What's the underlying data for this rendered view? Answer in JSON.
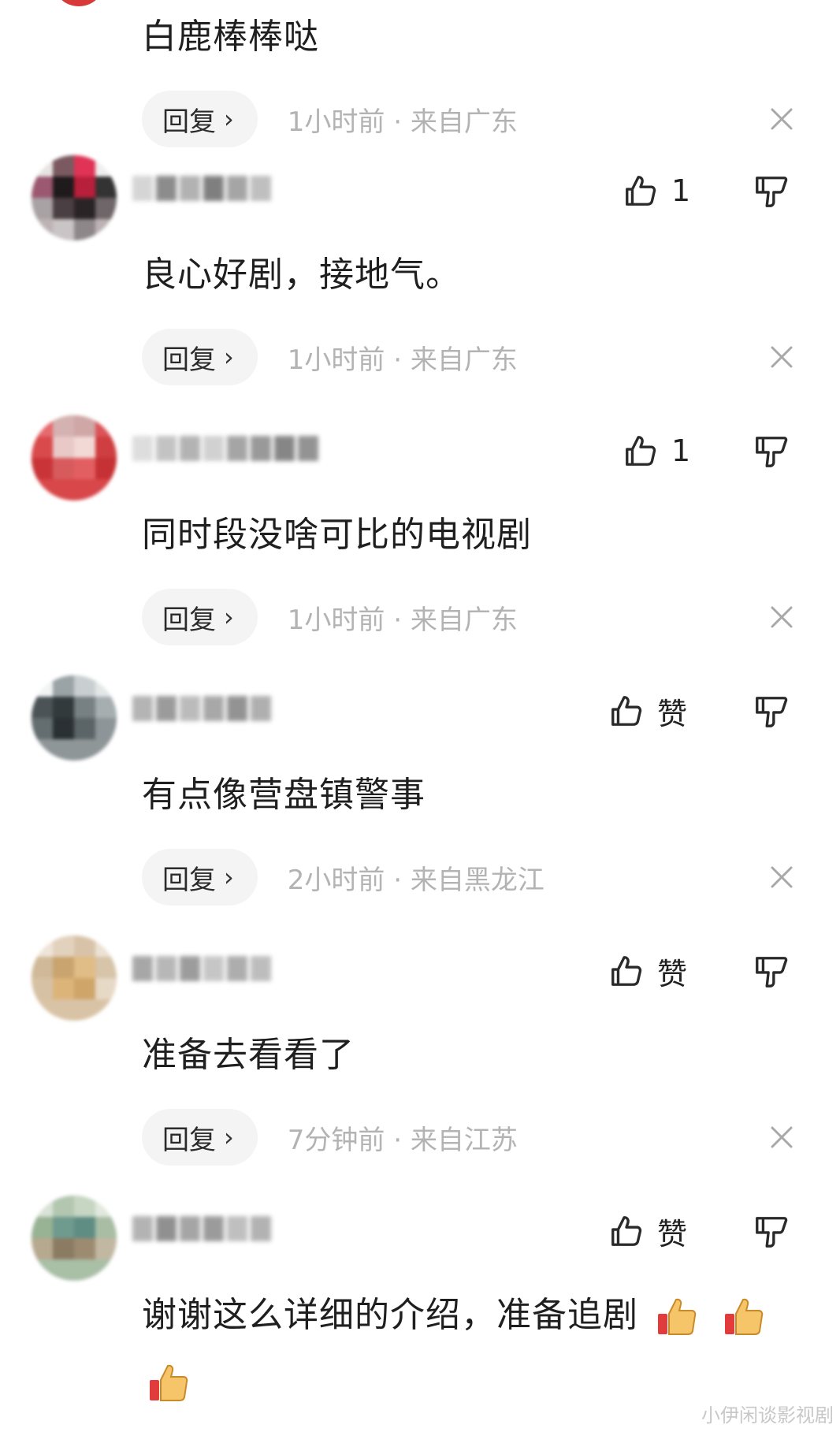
{
  "reply_label": "回复",
  "colors": {
    "meta_text": "#b3b3b3",
    "reply_bg": "#f4f4f4",
    "icon_stroke": "#2a2a2a",
    "top_avatar": "#d83a3a"
  },
  "icons": {
    "like": "thumbs-up-outline-icon",
    "dislike": "thumbs-down-outline-icon",
    "close": "close-icon",
    "reply_chevron": "chevron-right-icon",
    "emoji": "thumbs-up-emoji-icon"
  },
  "comments": [
    {
      "text": "白鹿棒棒哒",
      "meta": "1小时前 · 来自广东"
    },
    {
      "text": "良心好剧，接地气。",
      "meta": "1小时前 · 来自广东",
      "likes": "1"
    },
    {
      "text": "同时段没啥可比的电视剧",
      "meta": "1小时前 · 来自广东",
      "likes": "1"
    },
    {
      "text": "有点像营盘镇警事",
      "meta": "2小时前 · 来自黑龙江",
      "likes": "赞"
    },
    {
      "text": "准备去看看了",
      "meta": "7分钟前 · 来自江苏",
      "likes": "赞"
    },
    {
      "text": "谢谢这么详细的介绍，准备追剧",
      "likes": "赞"
    }
  ],
  "watermark": "小伊闲谈影视剧"
}
